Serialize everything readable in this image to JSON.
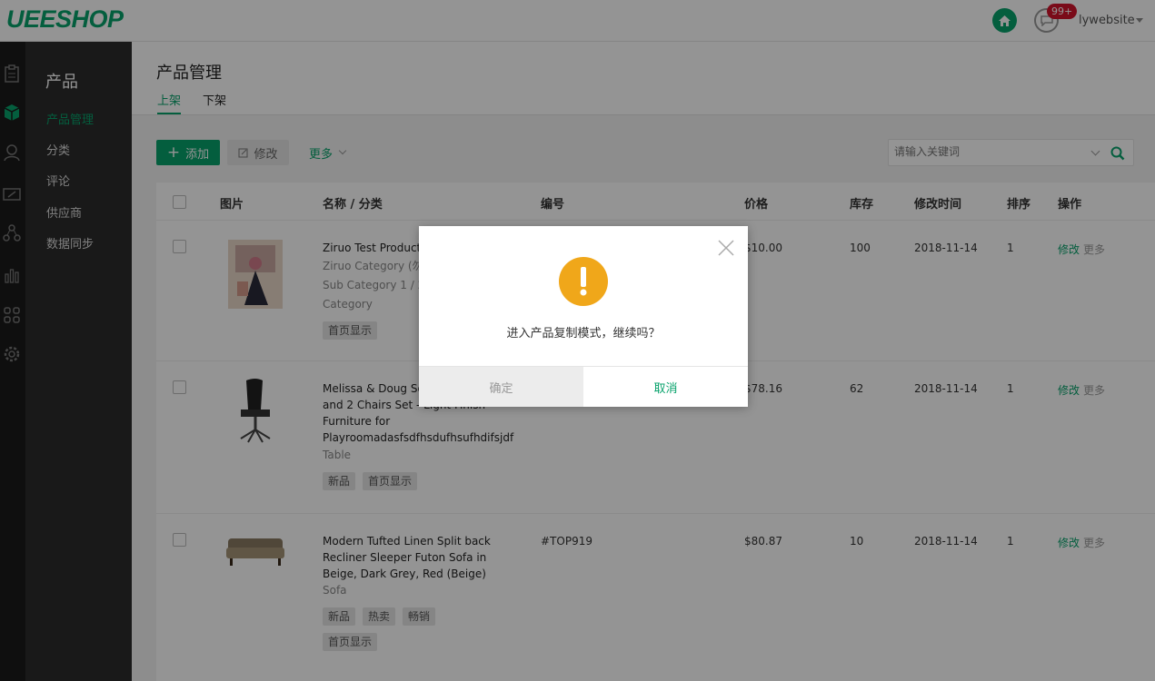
{
  "app": {
    "logo": "UEESHOP",
    "badge": "99+",
    "user": "lywebsite"
  },
  "sidebar": {
    "title": "产品",
    "items": [
      {
        "label": "产品管理",
        "active": true
      },
      {
        "label": "分类"
      },
      {
        "label": "评论"
      },
      {
        "label": "供应商"
      },
      {
        "label": "数据同步"
      }
    ],
    "rail_icons": [
      "orders-icon",
      "product-cube-icon",
      "user-icon",
      "ticket-icon",
      "share-icon",
      "chart-icon",
      "apps-icon",
      "settings-gear-icon"
    ]
  },
  "page": {
    "title": "产品管理",
    "tabs": [
      {
        "label": "上架",
        "active": true
      },
      {
        "label": "下架"
      }
    ]
  },
  "toolbar": {
    "add_label": "添加",
    "edit_label": "修改",
    "more_label": "更多",
    "search_placeholder": "请输入关键词"
  },
  "table": {
    "headers": [
      "图片",
      "名称 / 分类",
      "编号",
      "价格",
      "库存",
      "修改时间",
      "排序",
      "操作"
    ],
    "rows": [
      {
        "name": "Ziruo Test Product",
        "categories": [
          "Ziruo Category (勿",
          "Sub Category 1 / 2",
          "Category"
        ],
        "tags": [
          "首页显示"
        ],
        "number": "",
        "price": "$10.00",
        "stock": "100",
        "modified": "2018-11-14",
        "sort": "1",
        "op_edit": "修改",
        "op_more": "更多"
      },
      {
        "name": "Melissa & Doug Solid Wood Table and 2 Chairs Set - Light Finish Furniture for Playroomadasfsdfhsdufhsufhdifsjdf",
        "categories": [
          "Table"
        ],
        "tags": [
          "新品",
          "首页显示"
        ],
        "number": "",
        "price": "$78.16",
        "stock": "62",
        "modified": "2018-11-14",
        "sort": "1",
        "op_edit": "修改",
        "op_more": "更多"
      },
      {
        "name": "Modern Tufted Linen Split back Recliner Sleeper Futon Sofa in Beige, Dark Grey, Red (Beige)",
        "categories": [
          "Sofa"
        ],
        "tags": [
          "新品",
          "热卖",
          "畅销",
          "首页显示"
        ],
        "number": "#TOP919",
        "price": "$80.87",
        "stock": "10",
        "modified": "2018-11-14",
        "sort": "1",
        "op_edit": "修改",
        "op_more": "更多"
      }
    ]
  },
  "dialog": {
    "message": "进入产品复制模式，继续吗？",
    "ok_label": "确定",
    "cancel_label": "取消"
  },
  "colors": {
    "accent": "#07a26b",
    "warning": "#f0a71a",
    "badge": "#d2142b"
  }
}
